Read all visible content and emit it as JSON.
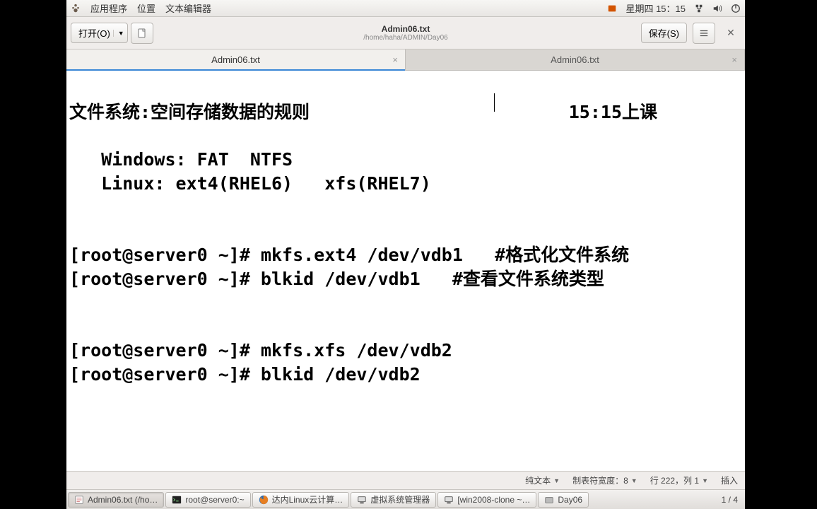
{
  "menubar": {
    "applications": "应用程序",
    "places": "位置",
    "editor": "文本编辑器",
    "clock": "星期四 15：15"
  },
  "toolbar": {
    "open_label": "打开(O)",
    "save_label": "保存(S)",
    "title": "Admin06.txt",
    "subtitle": "/home/haha/ADMIN/Day06"
  },
  "tabs": [
    {
      "label": "Admin06.txt",
      "active": true
    },
    {
      "label": "Admin06.txt",
      "active": false
    }
  ],
  "editor": {
    "heading_left": "文件系统:空间存储数据的规则",
    "heading_right": "15:15上课",
    "l2": "   Windows: FAT  NTFS",
    "l3": "   Linux: ext4(RHEL6)   xfs(RHEL7)",
    "l4": "[root@server0 ~]# mkfs.ext4 /dev/vdb1   #格式化文件系统",
    "l5": "[root@server0 ~]# blkid /dev/vdb1   #查看文件系统类型",
    "l6": "[root@server0 ~]# mkfs.xfs /dev/vdb2",
    "l7": "[root@server0 ~]# blkid /dev/vdb2"
  },
  "statusbar": {
    "syntax": "纯文本",
    "tabwidth": "制表符宽度：8",
    "position": "行 222，列 1",
    "insert": "插入"
  },
  "taskbar": {
    "items": [
      {
        "label": "Admin06.txt (/ho…"
      },
      {
        "label": "root@server0:~"
      },
      {
        "label": "达内Linux云计算…"
      },
      {
        "label": "虚拟系统管理器"
      },
      {
        "label": "[win2008-clone ~…"
      },
      {
        "label": "Day06"
      }
    ],
    "pager": "1 / 4"
  }
}
